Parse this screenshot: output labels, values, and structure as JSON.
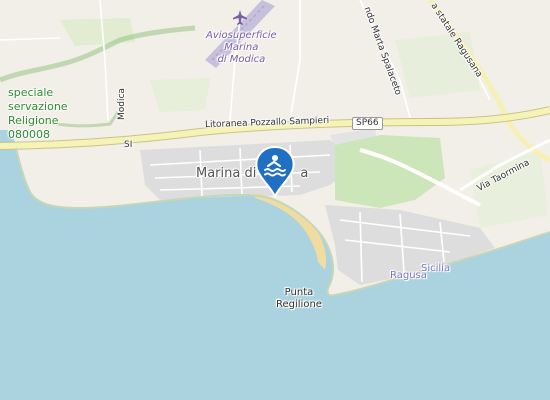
{
  "map": {
    "colors": {
      "sea": "#aad3df",
      "land": "#f2efe9",
      "urban": "#dddddd",
      "beach": "#f0dca0",
      "scrub": "#c8e3b8",
      "park": "#cde6b9",
      "road_primary": "#f5f3b6",
      "road_casing": "#c9c38a",
      "marker": "#1f6fc2"
    },
    "labels": {
      "reserve_line1": "speciale",
      "reserve_line2": "servazione",
      "reserve_line3": "Religione",
      "reserve_code": "080008",
      "airport_line1": "Aviosuperficie",
      "airport_line2": "Marina",
      "airport_line3": "di Modica",
      "modica_vertical": "Modica",
      "town": "Marina di Modica",
      "town_visible": "Marina di",
      "town_tail": "a",
      "litoranea": "Litoranea Pozzallo Sampieri",
      "road_badge": "SP66",
      "road_sign_left": "SI",
      "ragusa_state": "a statale Ragusana",
      "marta_road": "ndo Marta Spalaceto",
      "via_taormina": "Via Taormina",
      "ragusa": "Ragusa",
      "sicilia": "Sicilia",
      "cape_line1": "Punta",
      "cape_line2": "Regilione"
    },
    "marker": {
      "type": "beach-swimming-marker",
      "icon": "swimmer-waves-icon"
    }
  }
}
